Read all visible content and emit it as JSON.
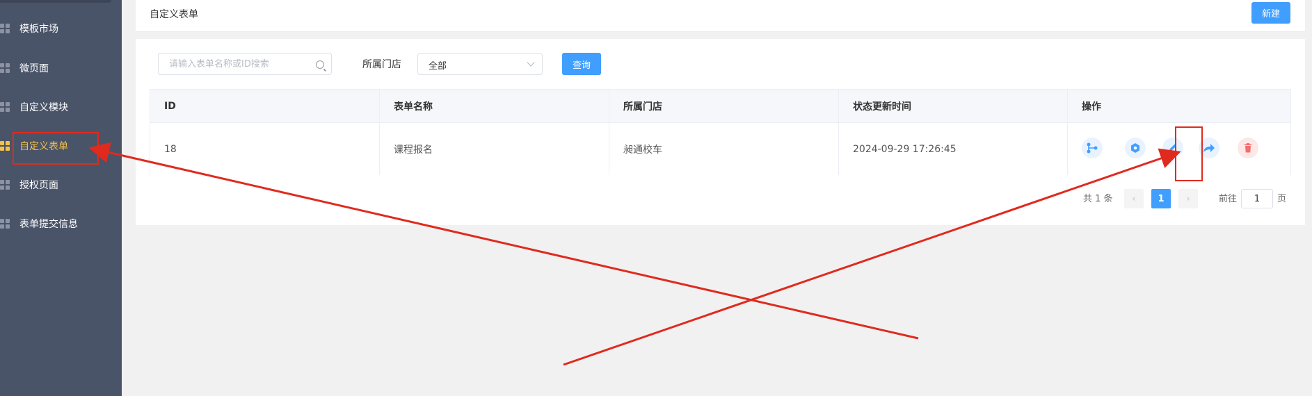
{
  "sidebar": {
    "items": [
      {
        "label": "模板市场"
      },
      {
        "label": "微页面"
      },
      {
        "label": "自定义模块"
      },
      {
        "label": "自定义表单",
        "active": true
      },
      {
        "label": "授权页面"
      },
      {
        "label": "表单提交信息"
      }
    ]
  },
  "header": {
    "title": "自定义表单",
    "new_button": "新建"
  },
  "filters": {
    "search_placeholder": "请输入表单名称或ID搜索",
    "search_value": "",
    "store_label": "所属门店",
    "store_value": "全部",
    "query_button": "查询"
  },
  "table": {
    "headers": [
      "ID",
      "表单名称",
      "所属门店",
      "状态更新时间",
      "操作"
    ],
    "rows": [
      {
        "id": "18",
        "name": "课程报名",
        "store": "昶通校车",
        "updated": "2024-09-29 17:26:45"
      }
    ],
    "actions": [
      {
        "icon": "share-tree-icon"
      },
      {
        "icon": "settings-hex-icon"
      },
      {
        "icon": "edit-pencil-icon"
      },
      {
        "icon": "forward-share-icon"
      },
      {
        "icon": "delete-trash-icon"
      }
    ]
  },
  "pagination": {
    "total_text": "共 1 条",
    "current_page": "1",
    "goto_label": "前往",
    "goto_value": "1",
    "page_suffix": "页"
  },
  "colors": {
    "sidebar_bg": "#4a5468",
    "accent": "#409eff",
    "active": "#f5c24a",
    "annotation": "#e02a1e"
  }
}
